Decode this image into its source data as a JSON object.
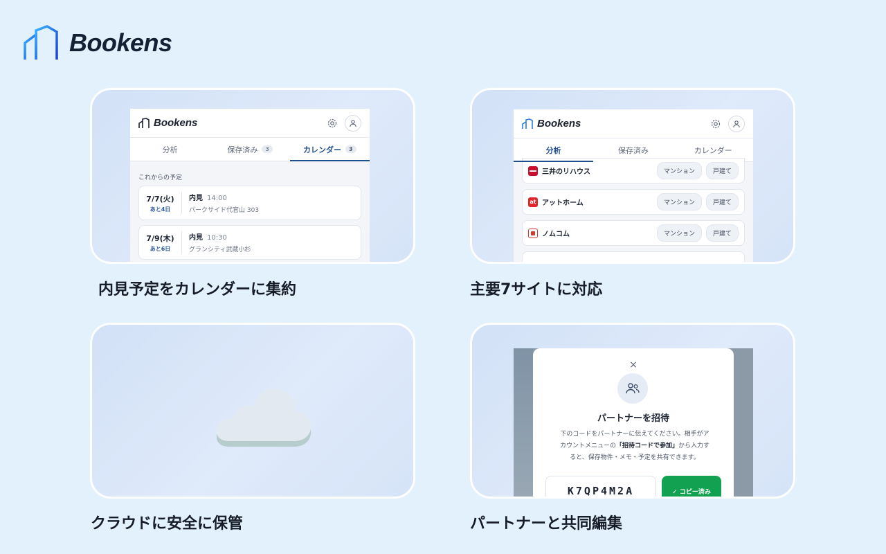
{
  "brand": {
    "name": "Bookens"
  },
  "cards": [
    {
      "caption": "内見予定をカレンダーに集約",
      "app_name": "Bookens",
      "tabs": [
        {
          "label": "分析",
          "badge": ""
        },
        {
          "label": "保存済み",
          "badge": "3"
        },
        {
          "label": "カレンダー",
          "badge": "3"
        }
      ],
      "section_label": "これからの予定",
      "events": [
        {
          "date": "7/7(火)",
          "left": "あと4日",
          "title": "内見",
          "time": "14:00",
          "address": "パークサイド代官山 303"
        },
        {
          "date": "7/9(木)",
          "left": "あと6日",
          "title": "内見",
          "time": "10:30",
          "address": "グランシティ武蔵小杉"
        }
      ]
    },
    {
      "caption": "主要7サイトに対応",
      "app_name": "Bookens",
      "tabs": [
        {
          "label": "分析"
        },
        {
          "label": "保存済み"
        },
        {
          "label": "カレンダー"
        }
      ],
      "sites": [
        {
          "name": "三井のリハウス",
          "logo_text": "",
          "color": "#c8102e",
          "pill1": "マンション",
          "pill2": "戸建て"
        },
        {
          "name": "アットホーム",
          "logo_text": "at",
          "color": "#e0262b",
          "pill1": "マンション",
          "pill2": "戸建て"
        },
        {
          "name": "ノムコム",
          "logo_text": "",
          "color": "#d13a2f",
          "pill1": "マンション",
          "pill2": "戸建て"
        }
      ]
    },
    {
      "caption": "クラウドに安全に保管"
    },
    {
      "caption": "パートナーと共同編集",
      "modal": {
        "close": "×",
        "title": "パートナーを招待",
        "desc_1": "下のコードをパートナーに伝えてください。相手がア",
        "desc_2a": "カウントメニューの",
        "desc_2b": "「招待コードで参加」",
        "desc_2c": "から入力す",
        "desc_3": "ると、保存物件・メモ・予定を共有できます。",
        "code": "K7QP4M2A",
        "copy_label": "✓ コピー済み"
      }
    }
  ]
}
